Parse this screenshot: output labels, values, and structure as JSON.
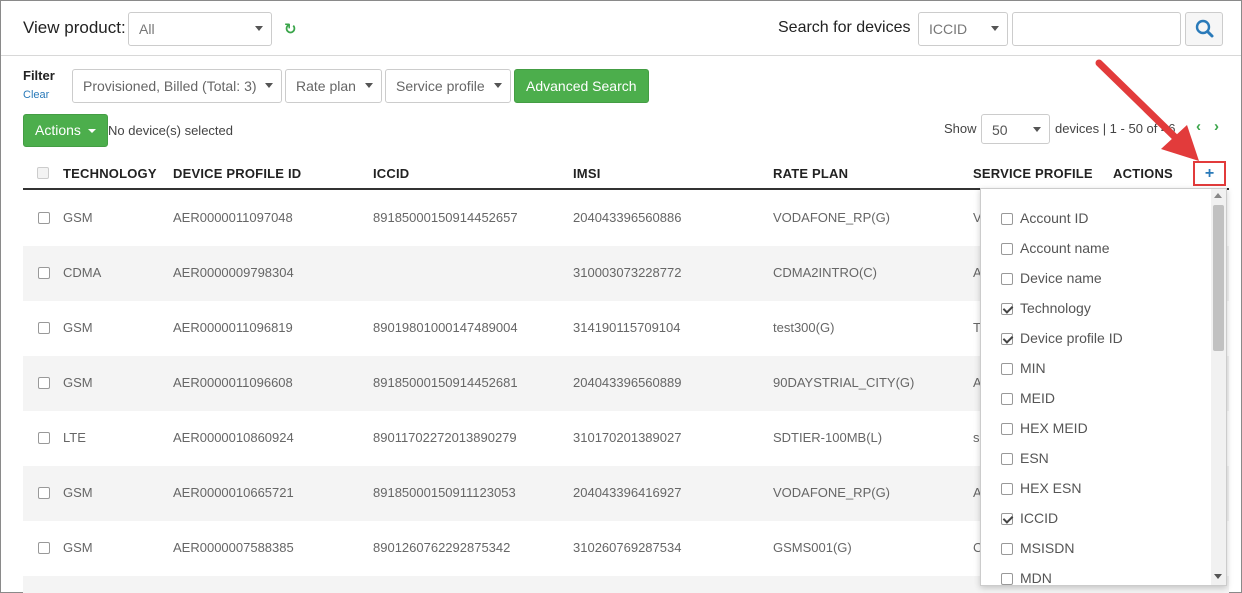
{
  "header": {
    "view_product_label": "View product:",
    "view_product_value": "All",
    "search_label": "Search for devices",
    "search_type_value": "ICCID",
    "search_value": ""
  },
  "filter": {
    "label": "Filter",
    "clear_label": "Clear",
    "status_value": "Provisioned, Billed (Total: 3)",
    "rate_plan_value": "Rate plan",
    "service_profile_value": "Service profile",
    "advanced_search_label": "Advanced Search"
  },
  "toolbar": {
    "actions_label": "Actions",
    "selection_text": "No device(s) selected",
    "show_label": "Show",
    "page_size_value": "50",
    "devices_text": "devices | 1 - 50 of 46"
  },
  "table": {
    "headers": [
      "TECHNOLOGY",
      "DEVICE PROFILE ID",
      "ICCID",
      "IMSI",
      "RATE PLAN",
      "SERVICE PROFILE",
      "ACTIONS"
    ],
    "rows": [
      {
        "technology": "GSM",
        "device_profile_id": "AER0000011097048",
        "iccid": "89185000150914452657",
        "imsi": "204043396560886",
        "rate_plan": "VODAFONE_RP(G)",
        "service_profile": "V"
      },
      {
        "technology": "CDMA",
        "device_profile_id": "AER0000009798304",
        "iccid": "",
        "imsi": "310003073228772",
        "rate_plan": "CDMA2INTRO(C)",
        "service_profile": "A"
      },
      {
        "technology": "GSM",
        "device_profile_id": "AER0000011096819",
        "iccid": "89019801000147489004",
        "imsi": "314190115709104",
        "rate_plan": "test300(G)",
        "service_profile": "T"
      },
      {
        "technology": "GSM",
        "device_profile_id": "AER0000011096608",
        "iccid": "89185000150914452681",
        "imsi": "204043396560889",
        "rate_plan": "90DAYSTRIAL_CITY(G)",
        "service_profile": "A"
      },
      {
        "technology": "LTE",
        "device_profile_id": "AER0000010860924",
        "iccid": "89011702272013890279",
        "imsi": "310170201389027",
        "rate_plan": "SDTIER-100MB(L)",
        "service_profile": "s"
      },
      {
        "technology": "GSM",
        "device_profile_id": "AER0000010665721",
        "iccid": "89185000150911123053",
        "imsi": "204043396416927",
        "rate_plan": "VODAFONE_RP(G)",
        "service_profile": "A"
      },
      {
        "technology": "GSM",
        "device_profile_id": "AER0000007588385",
        "iccid": "8901260762292875342",
        "imsi": "310260769287534",
        "rate_plan": "GSMS001(G)",
        "service_profile": "C"
      }
    ]
  },
  "columns_menu": {
    "add_label": "+",
    "options": [
      {
        "label": "Account ID",
        "checked": false
      },
      {
        "label": "Account name",
        "checked": false
      },
      {
        "label": "Device name",
        "checked": false
      },
      {
        "label": "Technology",
        "checked": true
      },
      {
        "label": "Device profile ID",
        "checked": true
      },
      {
        "label": "MIN",
        "checked": false
      },
      {
        "label": "MEID",
        "checked": false
      },
      {
        "label": "HEX MEID",
        "checked": false
      },
      {
        "label": "ESN",
        "checked": false
      },
      {
        "label": "HEX ESN",
        "checked": false
      },
      {
        "label": "ICCID",
        "checked": true
      },
      {
        "label": "MSISDN",
        "checked": false
      },
      {
        "label": "MDN",
        "checked": false
      }
    ]
  },
  "colors": {
    "accent_green": "#4cae4c",
    "link_blue": "#2a7ab9",
    "annotation_red": "#e23b3b"
  }
}
